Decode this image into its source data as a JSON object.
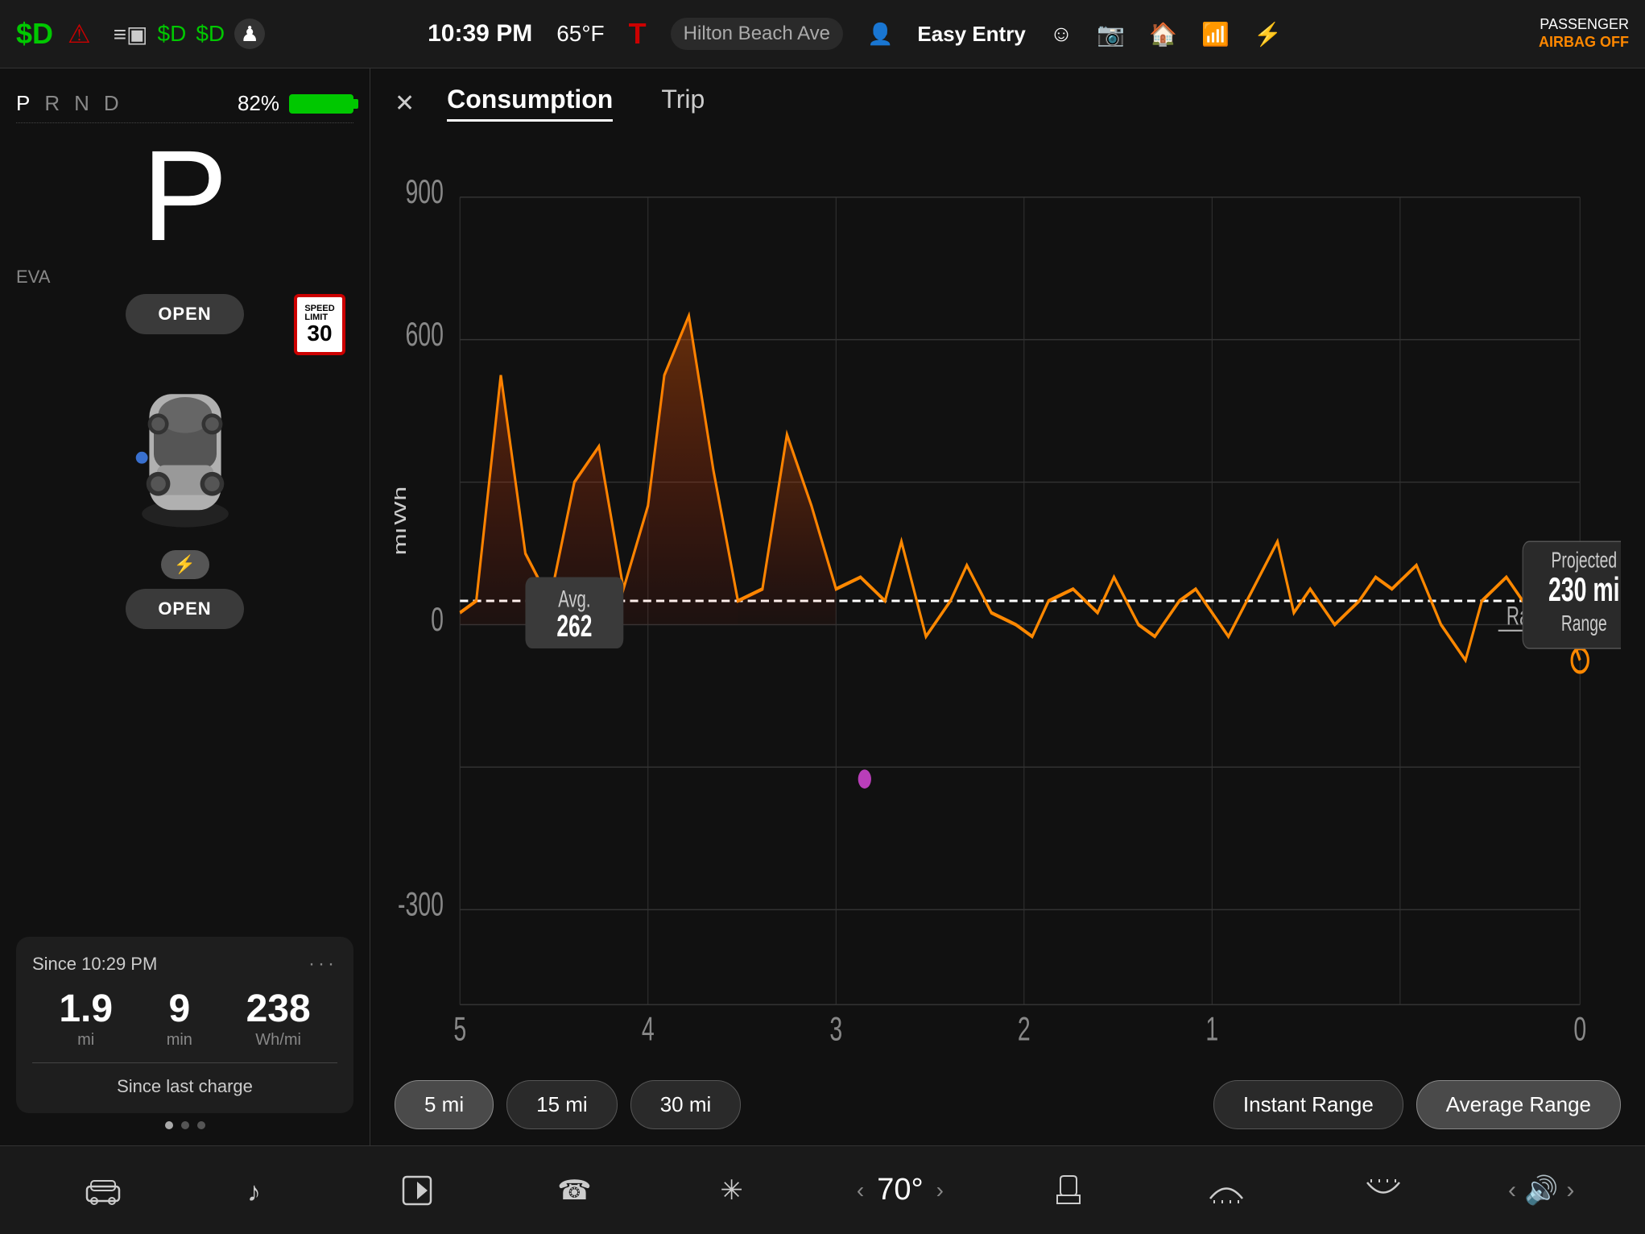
{
  "statusBar": {
    "leftIcons": {
      "dollarD": "$D",
      "warningIcon": "⚠",
      "docIcon": "≡",
      "energyIcon1": "$D",
      "energyIcon2": "$D",
      "personIcon": "🚶"
    },
    "time": "10:39 PM",
    "temp": "65°F",
    "teslaLogo": "T",
    "navText": "Hilton Beach Ave",
    "easyEntry": "Easy Entry",
    "passengerAirbag": "PASSENGER",
    "airbagStatus": "AIRBAG",
    "airbagValue": "OFF"
  },
  "leftPanel": {
    "gear": "P",
    "prnd": [
      "P",
      "R",
      "N",
      "D"
    ],
    "activeGear": "P",
    "batteryPercent": "82%",
    "evaLabel": "EVA",
    "openTopLabel": "OPEN",
    "openBottomLabel": "OPEN",
    "speedLimit": {
      "top": "SPEED LIMIT",
      "value": "30"
    },
    "stats": {
      "sinceLabel": "Since 10:29 PM",
      "miles": "1.9",
      "milesUnit": "mi",
      "minutes": "9",
      "minutesUnit": "min",
      "wh": "238",
      "whUnit": "Wh/mi",
      "sinceLastCharge": "Since last charge"
    }
  },
  "rightPanel": {
    "closeBtn": "✕",
    "tabs": [
      "Consumption",
      "Trip"
    ],
    "activeTab": "Consumption",
    "chart": {
      "yAxisLabels": [
        "900",
        "600",
        "0",
        "-300"
      ],
      "xAxisLabels": [
        "5",
        "4",
        "3",
        "2",
        "1",
        "0"
      ],
      "yAxisUnit": "Wh\nmi",
      "avgLabel": "Avg.",
      "avgValue": "262",
      "ratedLabel": "Rated",
      "projectedLabel": "Projected",
      "projectedValue": "230 mi",
      "projectedUnit": "Range"
    },
    "buttons": {
      "range5": "5 mi",
      "range15": "15 mi",
      "range30": "30 mi",
      "instantRange": "Instant Range",
      "averageRange": "Average Range",
      "activeRangeBtn": "5 mi",
      "activeTypeBtn": "Average Range"
    }
  },
  "bottomBar": {
    "carIcon": "🚗",
    "musicIcon": "♪",
    "mediaIcon": "⬆",
    "phoneIcon": "☎",
    "fanIcon": "⊛",
    "tempLeft": "‹",
    "tempValue": "70°",
    "tempRight": "›",
    "seatIcon": "🪑",
    "defrostIcon": "⌁",
    "rearDefrostIcon": "⌁",
    "volLeft": "‹",
    "volIcon": "🔊",
    "volRight": "›"
  }
}
